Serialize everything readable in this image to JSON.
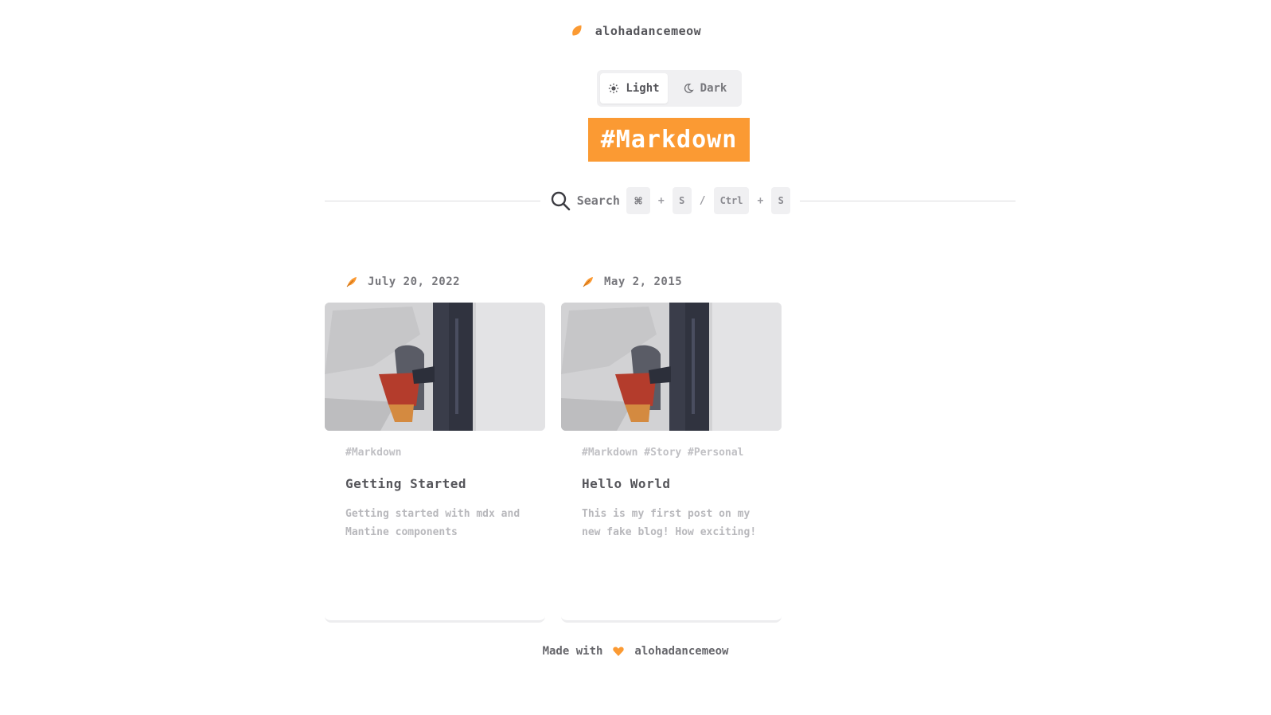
{
  "header": {
    "brand": "alohadancemeow"
  },
  "theme_toggle": {
    "light_label": "Light",
    "dark_label": "Dark",
    "selected": "light"
  },
  "tag_banner": "#Markdown",
  "search": {
    "label": "Search",
    "shortcut_mac_key": "S",
    "shortcut_mac_symbol": "⌘",
    "shortcut_separator": "/",
    "shortcut_win_modifier": "Ctrl",
    "shortcut_win_key": "S",
    "plus": "+"
  },
  "posts": [
    {
      "date": "July 20, 2022",
      "tags": "#Markdown",
      "title": "Getting Started",
      "description": "Getting started with mdx and Mantine components"
    },
    {
      "date": "May 2, 2015",
      "tags": "#Markdown #Story #Personal",
      "title": "Hello World",
      "description": "This is my first post on my new fake blog! How exciting!"
    }
  ],
  "footer": {
    "prefix": "Made with",
    "author": "alohadancemeow"
  },
  "colors": {
    "accent": "#fb9a33",
    "text": "#55555a",
    "muted": "#b8b8bc"
  }
}
